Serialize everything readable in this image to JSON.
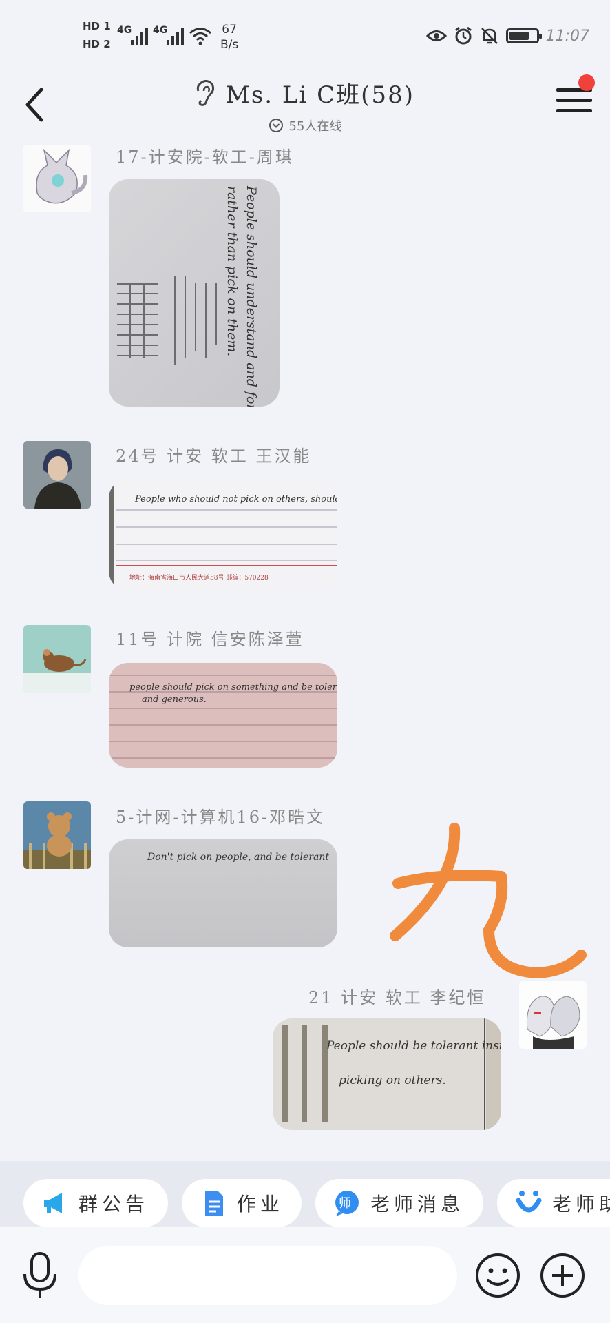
{
  "status_bar": {
    "hd1": "HD 1",
    "hd2": "HD 2",
    "sig1": "4G",
    "sig2": "4G",
    "speed_value": "67",
    "speed_unit": "B/s",
    "time": "11:07"
  },
  "header": {
    "title": "Ms. Li C班(58)",
    "online": "55人在线"
  },
  "messages": [
    {
      "sender": "17-计安院-软工-周琪",
      "photo_text": [
        "People should understand and forgive others",
        "rather than pick on them."
      ]
    },
    {
      "sender": "24号 计安 软工 王汉能",
      "photo_text": [
        "People who should not pick on others, should be tolerant",
        "地址：海南省海口市人民大道58号    邮编：570228"
      ]
    },
    {
      "sender": "11号 计院 信安陈泽萱",
      "photo_text": [
        "people should pick on something and be tolerant",
        "and generous."
      ]
    },
    {
      "sender": "5-计网-计算机16-邓晧文",
      "photo_text": [
        "Don't pick on people, and be tolerant"
      ]
    },
    {
      "sender": "21 计安 软工 李纪恒",
      "photo_text": [
        "People should be tolerant instead of",
        "picking on others."
      ]
    }
  ],
  "quick_actions": [
    {
      "label": "群公告",
      "icon": "megaphone-icon"
    },
    {
      "label": "作业",
      "icon": "document-icon"
    },
    {
      "label": "老师消息",
      "icon": "teacher-badge-icon"
    },
    {
      "label": "老师助",
      "icon": "smile-u-icon"
    }
  ],
  "input": {
    "placeholder": ""
  },
  "colors": {
    "accent_orange": "#f08a3c",
    "notify_red": "#f0423a",
    "background": "#f2f3f8"
  }
}
